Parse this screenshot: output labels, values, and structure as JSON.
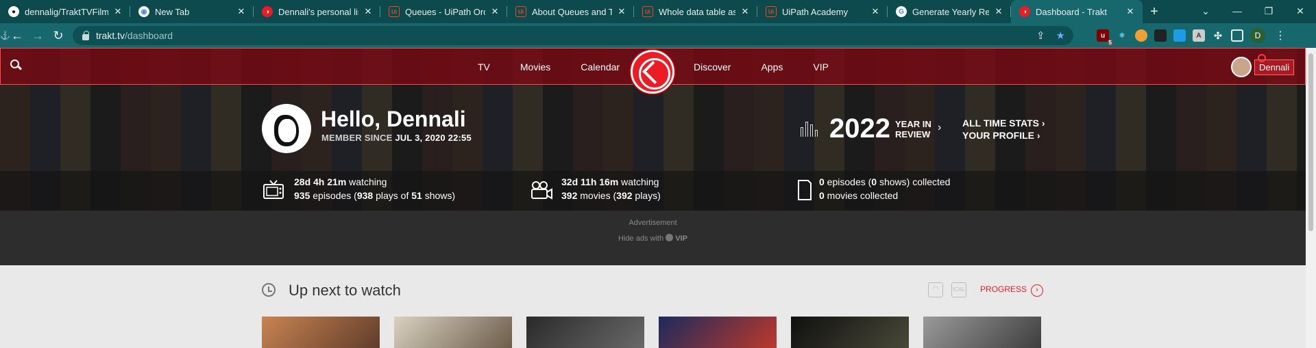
{
  "browser": {
    "tabs": [
      {
        "title": "dennalig/TraktTVFilmF",
        "favicon": "github-icon"
      },
      {
        "title": "New Tab",
        "favicon": "chrome-icon"
      },
      {
        "title": "Dennali's personal list",
        "favicon": "trakt-icon"
      },
      {
        "title": "Queues - UiPath Orche",
        "favicon": "uipath-icon"
      },
      {
        "title": "About Queues and Tra",
        "favicon": "uipath-icon"
      },
      {
        "title": "Whole data table as si",
        "favicon": "uipath-icon"
      },
      {
        "title": "UiPath Academy",
        "favicon": "uipath-icon"
      },
      {
        "title": "Generate Yearly Repor",
        "favicon": "google-icon"
      },
      {
        "title": "Dashboard - Trakt",
        "favicon": "trakt-icon",
        "active": true
      }
    ],
    "url_host": "trakt.tv",
    "url_path": "/dashboard",
    "profile_initial": "D",
    "ext_badge": "5",
    "accent": "#17686d"
  },
  "trakt": {
    "nav": {
      "left": [
        "TV",
        "Movies",
        "Calendar"
      ],
      "right": [
        "Discover",
        "Apps",
        "VIP"
      ],
      "username": "Dennali"
    },
    "hero": {
      "greeting": "Hello, Dennali",
      "member_prefix": "MEMBER SINCE",
      "member_date": "JUL 3, 2020 22:55",
      "year": "2022",
      "year_in": "YEAR IN",
      "review": "REVIEW",
      "all_time_stats": "ALL TIME STATS",
      "your_profile": "YOUR PROFILE"
    },
    "stats": {
      "tv_time": "28d 4h 21m",
      "watching_label": "watching",
      "tv_episodes": "935",
      "tv_plays": "938",
      "tv_shows": "51",
      "movie_time": "32d 11h 16m",
      "movies": "392",
      "movie_plays": "392",
      "collected_episodes": "0",
      "collected_shows": "0",
      "collected_movies": "0"
    },
    "ad": {
      "label": "Advertisement",
      "hide": "Hide ads with",
      "vip": "VIP"
    },
    "up_next": {
      "title": "Up next to watch",
      "progress_label": "PROGRESS"
    },
    "brand_color": "#ed1c24"
  }
}
